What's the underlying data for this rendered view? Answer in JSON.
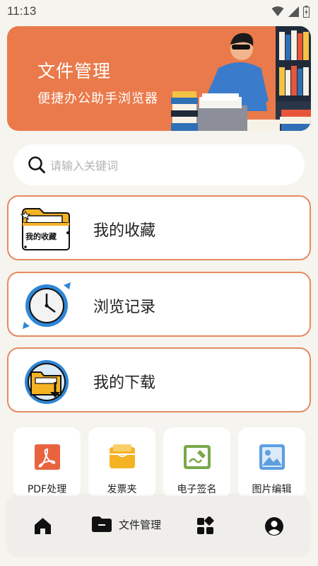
{
  "status_bar": {
    "time": "11:13",
    "icons": [
      "wifi-icon",
      "signal-icon",
      "battery-icon"
    ]
  },
  "banner": {
    "title": "文件管理",
    "subtitle": "便捷办公助手浏览器",
    "background": "#ea7a4b"
  },
  "search": {
    "placeholder": "请输入关键词"
  },
  "menu": {
    "items": [
      {
        "label": "我的收藏",
        "icon": "favorites-folder-icon",
        "icon_text": "我的收藏"
      },
      {
        "label": "浏览记录",
        "icon": "history-clock-icon"
      },
      {
        "label": "我的下载",
        "icon": "download-folder-icon"
      }
    ],
    "border_color": "#e58a5f"
  },
  "tools": {
    "items": [
      {
        "label": "PDF处理",
        "icon": "pdf-icon",
        "color": "#e9633f"
      },
      {
        "label": "发票夹",
        "icon": "invoice-folder-icon",
        "color": "#f5b324"
      },
      {
        "label": "电子签名",
        "icon": "signature-icon",
        "color": "#7aa84a"
      },
      {
        "label": "图片编辑",
        "icon": "image-edit-icon",
        "color": "#5d9ee0"
      }
    ]
  },
  "bottom_nav": {
    "items": [
      {
        "icon": "home-icon",
        "label": ""
      },
      {
        "icon": "folder-icon",
        "label": "文件管理",
        "active": true
      },
      {
        "icon": "apps-icon",
        "label": ""
      },
      {
        "icon": "profile-icon",
        "label": ""
      }
    ]
  }
}
